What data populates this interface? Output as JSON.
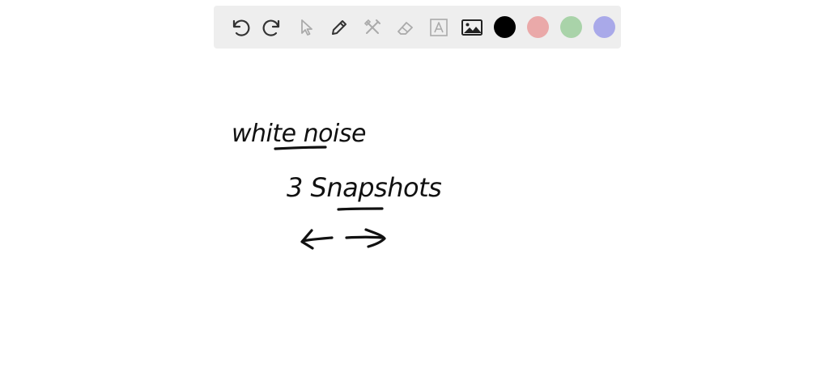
{
  "toolbar": {
    "tools": [
      {
        "id": "undo",
        "icon": "undo-icon"
      },
      {
        "id": "redo",
        "icon": "redo-icon"
      },
      {
        "id": "select",
        "icon": "cursor-icon"
      },
      {
        "id": "pen",
        "icon": "pencil-icon"
      },
      {
        "id": "tools",
        "icon": "wrench-tools-icon"
      },
      {
        "id": "eraser",
        "icon": "eraser-icon"
      },
      {
        "id": "text",
        "icon": "text-box-icon"
      },
      {
        "id": "image",
        "icon": "image-icon"
      }
    ],
    "colors": [
      "#000000",
      "#eaa9a9",
      "#a9d3a9",
      "#a9a9e9"
    ],
    "selected_color": "#000000"
  },
  "canvas": {
    "handwriting": {
      "line1": "white noise",
      "line2": "3 Snapshots"
    }
  }
}
